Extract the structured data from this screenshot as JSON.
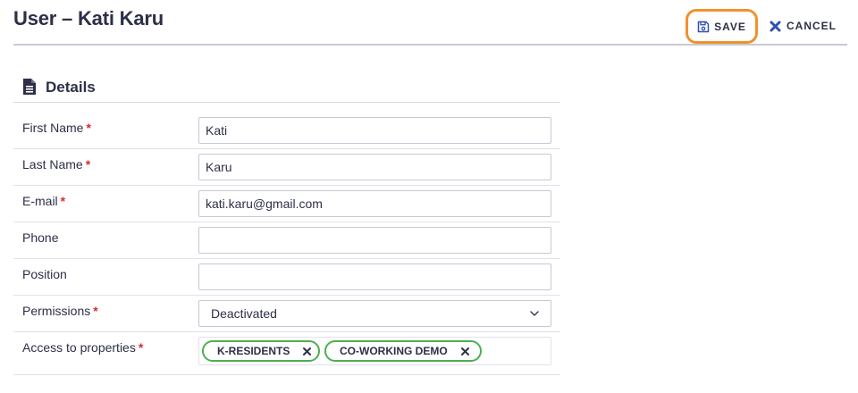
{
  "page": {
    "title": "User – Kati Karu"
  },
  "toolbar": {
    "save_label": "SAVE",
    "cancel_label": "CANCEL"
  },
  "section": {
    "title": "Details"
  },
  "required_marker": "*",
  "fields": {
    "first_name": {
      "label": "First Name",
      "value": "Kati"
    },
    "last_name": {
      "label": "Last Name",
      "value": "Karu"
    },
    "email": {
      "label": "E-mail",
      "value": "kati.karu@gmail.com"
    },
    "phone": {
      "label": "Phone",
      "value": ""
    },
    "position": {
      "label": "Position",
      "value": ""
    },
    "permissions": {
      "label": "Permissions",
      "value": "Deactivated"
    },
    "properties": {
      "label": "Access to properties",
      "tags": [
        "K-RESIDENTS",
        "CO-WORKING DEMO"
      ]
    }
  },
  "colors": {
    "accent": "#f0922e",
    "tag_border": "#4caf50",
    "required": "#d92b2b",
    "icon": "#2f4fb5"
  },
  "icons": {
    "save": "floppy-disk-icon",
    "cancel": "close-icon",
    "section": "document-icon",
    "select": "chevron-down-icon",
    "tag_remove": "close-icon"
  }
}
